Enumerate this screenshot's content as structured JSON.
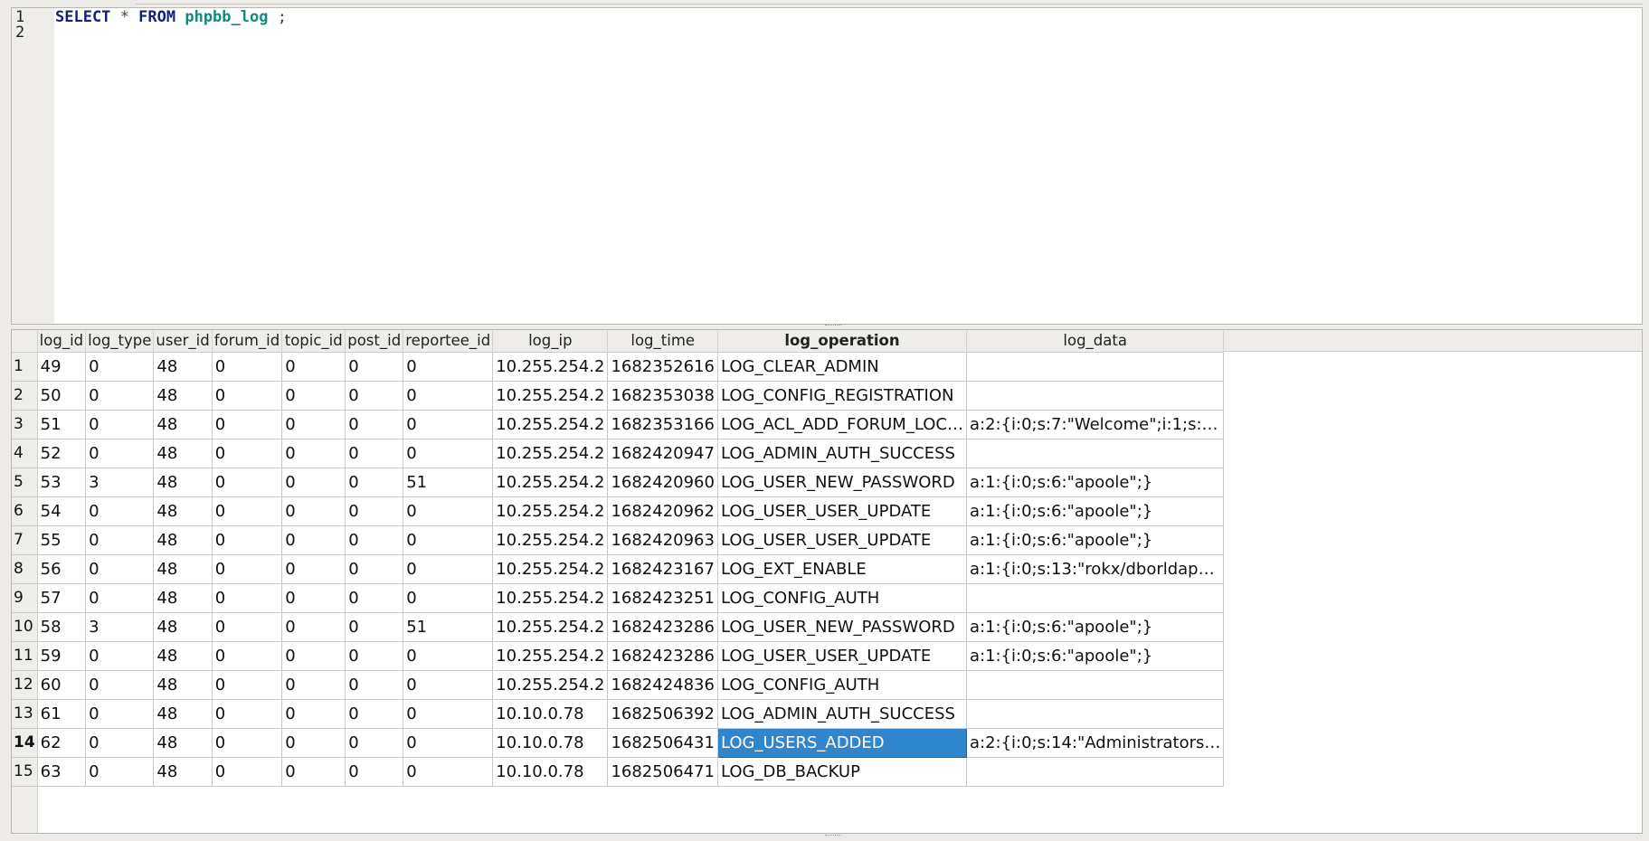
{
  "editor": {
    "lines": [
      "1",
      "2"
    ],
    "query": {
      "kw_select": "SELECT",
      "star": " * ",
      "kw_from": "FROM",
      "table": "phpbb_log",
      "terminator": " ;"
    }
  },
  "grid": {
    "columns": [
      "log_id",
      "log_type",
      "user_id",
      "forum_id",
      "topic_id",
      "post_id",
      "reportee_id",
      "log_ip",
      "log_time",
      "log_operation",
      "log_data"
    ],
    "sorted_column": "log_operation",
    "selected_row": 14,
    "selected_column": "log_operation",
    "rows": [
      [
        "1",
        "49",
        "0",
        "48",
        "0",
        "0",
        "0",
        "0",
        "10.255.254.2",
        "1682352616",
        "LOG_CLEAR_ADMIN",
        ""
      ],
      [
        "2",
        "50",
        "0",
        "48",
        "0",
        "0",
        "0",
        "0",
        "10.255.254.2",
        "1682353038",
        "LOG_CONFIG_REGISTRATION",
        ""
      ],
      [
        "3",
        "51",
        "0",
        "48",
        "0",
        "0",
        "0",
        "0",
        "10.255.254.2",
        "1682353166",
        "LOG_ACL_ADD_FORUM_LOC…",
        "a:2:{i:0;s:7:\"Welcome\";i:1;s:…"
      ],
      [
        "4",
        "52",
        "0",
        "48",
        "0",
        "0",
        "0",
        "0",
        "10.255.254.2",
        "1682420947",
        "LOG_ADMIN_AUTH_SUCCESS",
        ""
      ],
      [
        "5",
        "53",
        "3",
        "48",
        "0",
        "0",
        "0",
        "51",
        "10.255.254.2",
        "1682420960",
        "LOG_USER_NEW_PASSWORD",
        "a:1:{i:0;s:6:\"apoole\";}"
      ],
      [
        "6",
        "54",
        "0",
        "48",
        "0",
        "0",
        "0",
        "0",
        "10.255.254.2",
        "1682420962",
        "LOG_USER_USER_UPDATE",
        "a:1:{i:0;s:6:\"apoole\";}"
      ],
      [
        "7",
        "55",
        "0",
        "48",
        "0",
        "0",
        "0",
        "0",
        "10.255.254.2",
        "1682420963",
        "LOG_USER_USER_UPDATE",
        "a:1:{i:0;s:6:\"apoole\";}"
      ],
      [
        "8",
        "56",
        "0",
        "48",
        "0",
        "0",
        "0",
        "0",
        "10.255.254.2",
        "1682423167",
        "LOG_EXT_ENABLE",
        "a:1:{i:0;s:13:\"rokx/dborldap…"
      ],
      [
        "9",
        "57",
        "0",
        "48",
        "0",
        "0",
        "0",
        "0",
        "10.255.254.2",
        "1682423251",
        "LOG_CONFIG_AUTH",
        ""
      ],
      [
        "10",
        "58",
        "3",
        "48",
        "0",
        "0",
        "0",
        "51",
        "10.255.254.2",
        "1682423286",
        "LOG_USER_NEW_PASSWORD",
        "a:1:{i:0;s:6:\"apoole\";}"
      ],
      [
        "11",
        "59",
        "0",
        "48",
        "0",
        "0",
        "0",
        "0",
        "10.255.254.2",
        "1682423286",
        "LOG_USER_USER_UPDATE",
        "a:1:{i:0;s:6:\"apoole\";}"
      ],
      [
        "12",
        "60",
        "0",
        "48",
        "0",
        "0",
        "0",
        "0",
        "10.255.254.2",
        "1682424836",
        "LOG_CONFIG_AUTH",
        ""
      ],
      [
        "13",
        "61",
        "0",
        "48",
        "0",
        "0",
        "0",
        "0",
        "10.10.0.78",
        "1682506392",
        "LOG_ADMIN_AUTH_SUCCESS",
        ""
      ],
      [
        "14",
        "62",
        "0",
        "48",
        "0",
        "0",
        "0",
        "0",
        "10.10.0.78",
        "1682506431",
        "LOG_USERS_ADDED",
        "a:2:{i:0;s:14:\"Administrators…"
      ],
      [
        "15",
        "63",
        "0",
        "48",
        "0",
        "0",
        "0",
        "0",
        "10.10.0.78",
        "1682506471",
        "LOG_DB_BACKUP",
        ""
      ]
    ]
  },
  "colors": {
    "selection": "#2f86cc",
    "keyword": "#14207a",
    "identifier": "#118a7e"
  }
}
